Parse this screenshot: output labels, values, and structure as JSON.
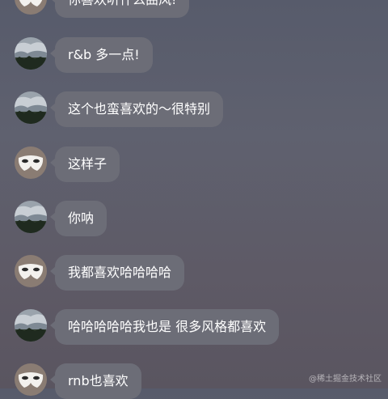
{
  "messages": [
    {
      "sender": "mask",
      "text": "你喜欢听什么曲风!"
    },
    {
      "sender": "landscape",
      "text": "r&b 多一点!"
    },
    {
      "sender": "landscape",
      "text": "这个也蛮喜欢的～很特别"
    },
    {
      "sender": "mask",
      "text": "这样子"
    },
    {
      "sender": "landscape",
      "text": "你呐"
    },
    {
      "sender": "mask",
      "text": "我都喜欢哈哈哈哈"
    },
    {
      "sender": "landscape",
      "text": "哈哈哈哈哈我也是 很多风格都喜欢"
    },
    {
      "sender": "mask",
      "text": "rnb也喜欢"
    }
  ],
  "watermark": "@稀土掘金技术社区",
  "avatars": {
    "mask": "white-mask-avatar",
    "landscape": "cloudy-landscape-avatar"
  },
  "colors": {
    "bubble": "#6c6d77",
    "text": "#ffffff"
  }
}
